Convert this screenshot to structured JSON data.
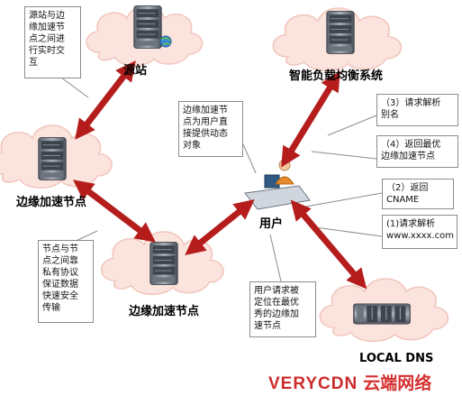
{
  "nodes": {
    "origin": "源站",
    "edge_top": "边缘加速节点",
    "edge_bottom": "边缘加速节点",
    "gslb": "智能负载均衡系统",
    "user": "用户",
    "local_dns": "LOCAL DNS"
  },
  "notes": {
    "origin_realtime": [
      "源站与边",
      "缘加速节",
      "点之间进",
      "行实时交",
      "互"
    ],
    "edge_serves_user": [
      "边缘加速节",
      "点为用户直",
      "接提供动态",
      "对象"
    ],
    "private_protocol": [
      "节点与节",
      "点之间靠",
      "私有协议",
      "保证数据",
      "快速安全",
      "传输"
    ],
    "user_located": [
      "用户请求被",
      "定位在最优",
      "秀的边缘加",
      "速节点"
    ],
    "step3": [
      "（3）请求解析",
      "别名"
    ],
    "step4": [
      "（4）返回最优",
      "边缘加速节点"
    ],
    "step2": [
      "（2）返回",
      "CNAME"
    ],
    "step1": [
      "(1)请求解析",
      "www.xxxx.com"
    ]
  },
  "brand": {
    "name": "VERYCDN",
    "subtitle": "云端网络"
  },
  "colors": {
    "arrow": "#b51d1d",
    "cloud_fill": "#fbe3de",
    "cloud_stroke": "#f1c4bb",
    "server_dark": "#4d5560",
    "server_light": "#9aa2aa",
    "connector": "#8c8c8c"
  }
}
